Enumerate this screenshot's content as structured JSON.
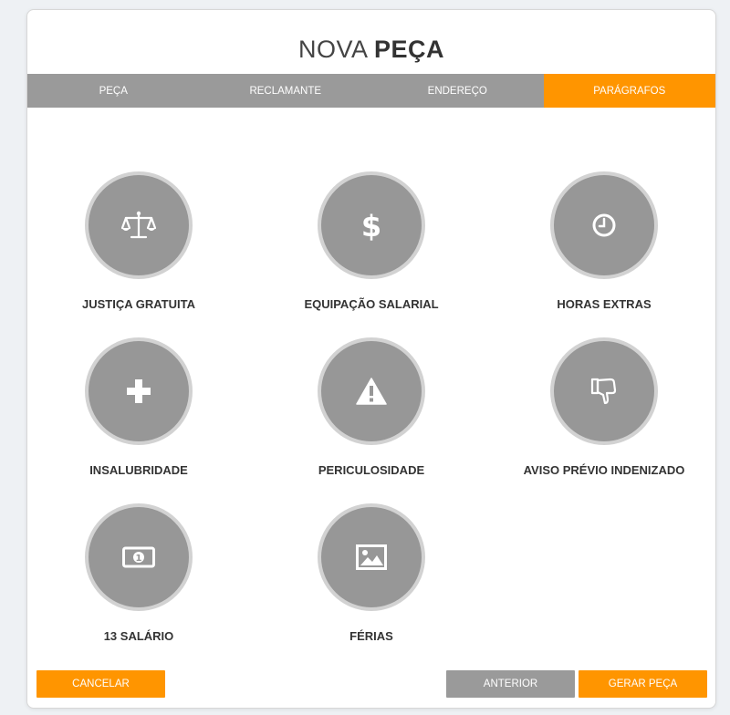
{
  "modal": {
    "title_light": "NOVA",
    "title_bold": "PEÇA"
  },
  "tabs": [
    {
      "label": "PEÇA",
      "active": false
    },
    {
      "label": "RECLAMANTE",
      "active": false
    },
    {
      "label": "ENDEREÇO",
      "active": false
    },
    {
      "label": "PARÁGRAFOS",
      "active": true
    }
  ],
  "items": [
    {
      "label": "JUSTIÇA GRATUITA",
      "icon": "scales-icon"
    },
    {
      "label": "EQUIPAÇÃO SALARIAL",
      "icon": "dollar-icon"
    },
    {
      "label": "HORAS EXTRAS",
      "icon": "clock-icon"
    },
    {
      "label": "INSALUBRIDADE",
      "icon": "plus-icon"
    },
    {
      "label": "PERICULOSIDADE",
      "icon": "warning-icon"
    },
    {
      "label": "AVISO PRÉVIO INDENIZADO",
      "icon": "thumbs-down-icon"
    },
    {
      "label": "13 SALÁRIO",
      "icon": "banknote-icon"
    },
    {
      "label": "FÉRIAS",
      "icon": "image-icon"
    }
  ],
  "buttons": {
    "cancel": "CANCELAR",
    "previous": "ANTERIOR",
    "generate": "GERAR PEÇA"
  },
  "colors": {
    "accent": "#ff9500",
    "tab_gray": "#9a9a9a",
    "circle_gray": "#979797"
  }
}
